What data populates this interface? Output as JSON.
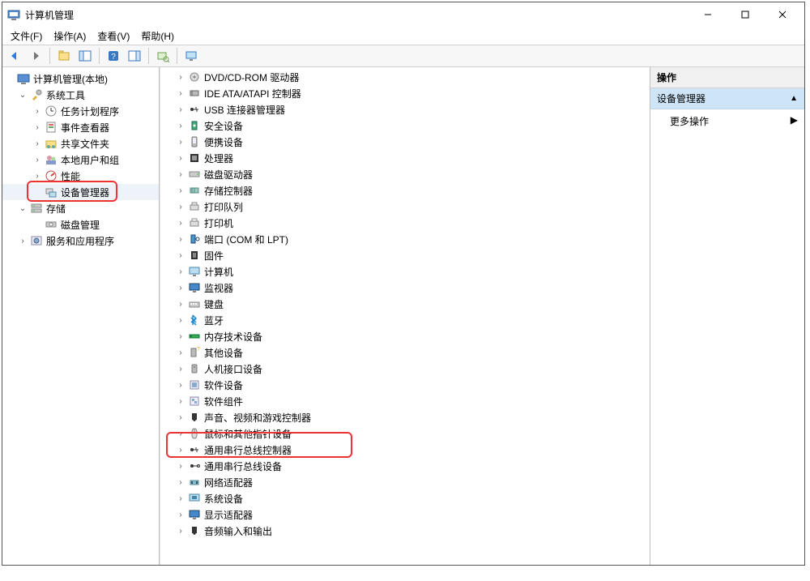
{
  "window": {
    "title": "计算机管理"
  },
  "menu": {
    "file": "文件(F)",
    "action": "操作(A)",
    "view": "查看(V)",
    "help": "帮助(H)"
  },
  "left_tree": {
    "root": "计算机管理(本地)",
    "system_tools": "系统工具",
    "task_scheduler": "任务计划程序",
    "event_viewer": "事件查看器",
    "shared_folders": "共享文件夹",
    "local_users": "本地用户和组",
    "performance": "性能",
    "device_manager": "设备管理器",
    "storage": "存储",
    "disk_mgmt": "磁盘管理",
    "services": "服务和应用程序"
  },
  "device_categories": [
    "DVD/CD-ROM 驱动器",
    "IDE ATA/ATAPI 控制器",
    "USB 连接器管理器",
    "安全设备",
    "便携设备",
    "处理器",
    "磁盘驱动器",
    "存储控制器",
    "打印队列",
    "打印机",
    "端口 (COM 和 LPT)",
    "固件",
    "计算机",
    "监视器",
    "键盘",
    "蓝牙",
    "内存技术设备",
    "其他设备",
    "人机接口设备",
    "软件设备",
    "软件组件",
    "声音、视频和游戏控制器",
    "鼠标和其他指针设备",
    "通用串行总线控制器",
    "通用串行总线设备",
    "网络适配器",
    "系统设备",
    "显示适配器",
    "音频输入和输出"
  ],
  "actions_pane": {
    "header": "操作",
    "section": "设备管理器",
    "more": "更多操作"
  },
  "highlights": {
    "left_device_manager_selected": true,
    "usb_controller_index": 23
  }
}
